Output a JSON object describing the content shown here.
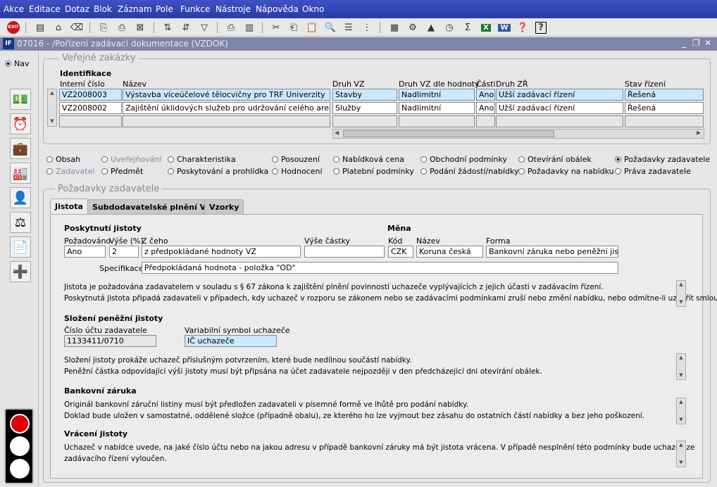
{
  "menu": [
    "Akce",
    "Editace",
    "Dotaz",
    "Blok",
    "Záznam",
    "Pole",
    "Funkce",
    "Nástroje",
    "Nápověda",
    "Okno"
  ],
  "window": {
    "title": "07016 - /Pořízení zadávací dokumentace (VZDOK)"
  },
  "left": {
    "nav_label": "Nav"
  },
  "verejne": {
    "title": "Veřejné zakázky",
    "section": "Identifikace",
    "headers": [
      "Interní číslo",
      "Název",
      "Druh VZ",
      "Druh VZ dle hodnoty",
      "Části",
      "Druh ZŘ",
      "Stav řízení"
    ],
    "rows": [
      {
        "cislo": "VZ2008003",
        "nazev": "Výstavba víceúčelové tělocvičny pro TRF Univerzity",
        "druh": "Stavby",
        "dle": "Nadlimitní",
        "casti": "Ano",
        "zr": "Užší zadávací řízení",
        "stav": "Řešená"
      },
      {
        "cislo": "VZ2008002",
        "nazev": "Zajištění úklidových služeb pro udržování celého areálu Univ",
        "druh": "Služby",
        "dle": "Nadlimitní",
        "casti": "Ano",
        "zr": "Užší zadávací řízení",
        "stav": "Řešená"
      }
    ]
  },
  "radios": [
    {
      "label": "Obsah",
      "on": false,
      "dis": false
    },
    {
      "label": "Uveřejňování",
      "on": false,
      "dis": true
    },
    {
      "label": "Charakteristika",
      "on": false,
      "dis": false
    },
    {
      "label": "Posouzení",
      "on": false,
      "dis": false
    },
    {
      "label": "Nabídková cena",
      "on": false,
      "dis": false
    },
    {
      "label": "Obchodní podmínky",
      "on": false,
      "dis": false
    },
    {
      "label": "Otevírání obálek",
      "on": false,
      "dis": false
    },
    {
      "label": "Požadavky zadavatele",
      "on": true,
      "dis": false
    },
    {
      "label": "Zadavatel",
      "on": false,
      "dis": true
    },
    {
      "label": "Předmět",
      "on": false,
      "dis": false
    },
    {
      "label": "Poskytování a prohlídka",
      "on": false,
      "dis": false
    },
    {
      "label": "Hodnocení",
      "on": false,
      "dis": false
    },
    {
      "label": "Platební podmínky",
      "on": false,
      "dis": false
    },
    {
      "label": "Podání žádostí/nabídky",
      "on": false,
      "dis": false
    },
    {
      "label": "Požadavky na nabídku",
      "on": false,
      "dis": false
    },
    {
      "label": "Práva zadavatele",
      "on": false,
      "dis": false
    }
  ],
  "pozadavky": {
    "title": "Požadavky zadavatele",
    "tabs": [
      "Jistota",
      "Subdodavatelské plnění VZ",
      "Vzorky"
    ],
    "poskytnuti": {
      "heading": "Poskytnutí jistoty",
      "h_pozadovano": "Požadováno",
      "h_vyse_pct": "Výše (%)",
      "h_z_ceho": "Z čeho",
      "h_vyse_castky": "Výše částky",
      "pozadovano": "Ano",
      "vyse_pct": "2",
      "z_ceho": "z předpokládané hodnoty VZ",
      "vyse_castky": "",
      "specifikace_label": "Specifikace",
      "specifikace": "Předpokládaná hodnota - položka \"OD\""
    },
    "mena": {
      "heading": "Měna",
      "h_kod": "Kód",
      "h_nazev": "Název",
      "h_forma": "Forma",
      "kod": "CZK",
      "nazev": "Koruna česká",
      "forma": "Bankovní záruka nebo peněžní jistota"
    },
    "text1": [
      "Jistota je požadována zadavatelem v souladu s § 67 zákona k zajištění plnění povinností uchazeče vyplývajících z jejich účasti v zadávacím řízení.",
      "Poskytnutá jistota připadá zadavateli v případech, kdy uchazeč v rozporu se zákonem nebo se zadávacími podmínkami zruší nebo změní nabídku, nebo odmítne-li uzavřít smlouvu"
    ],
    "slozeni": {
      "heading": "Složení peněžní jistoty",
      "h_ucet": "Číslo účtu zadavatele",
      "h_vs": "Variabilní symbol uchazeče",
      "ucet": "1133411/0710",
      "vs": "IČ uchazeče"
    },
    "text2": [
      "Složení jistoty prokáže uchazeč příslušným potvrzením, které bude nedílnou součástí nabídky.",
      "Peněžní částka odpovídající výši jistoty musí být připsána na účet zadavatele nejpozději v den předcházející dni otevírání obálek."
    ],
    "bankovni": {
      "heading": "Bankovní záruka",
      "text": [
        "Originál bankovní záruční listiny musí být předložen zadavateli v písemné formě ve lhůtě pro podání nabídky.",
        "Doklad bude uložen v samostatné, oddělené složce (případně obalu), ze kterého ho lze vyjmout bez zásahu do ostatních částí nabídky a bez jeho poškození."
      ]
    },
    "vraceni": {
      "heading": "Vrácení jistoty",
      "text": [
        "Uchazeč v nabídce uvede, na jaké číslo účtu nebo na jakou adresu v případě bankovní záruky má být jistota vrácena. V případě nesplnění této podmínky bude uchazeč ze",
        "zadávacího řízení vyloučen."
      ]
    }
  },
  "colors": {
    "menubar": "#2f40b0",
    "title": "#7e85a8",
    "selected": "#cce8ff"
  }
}
